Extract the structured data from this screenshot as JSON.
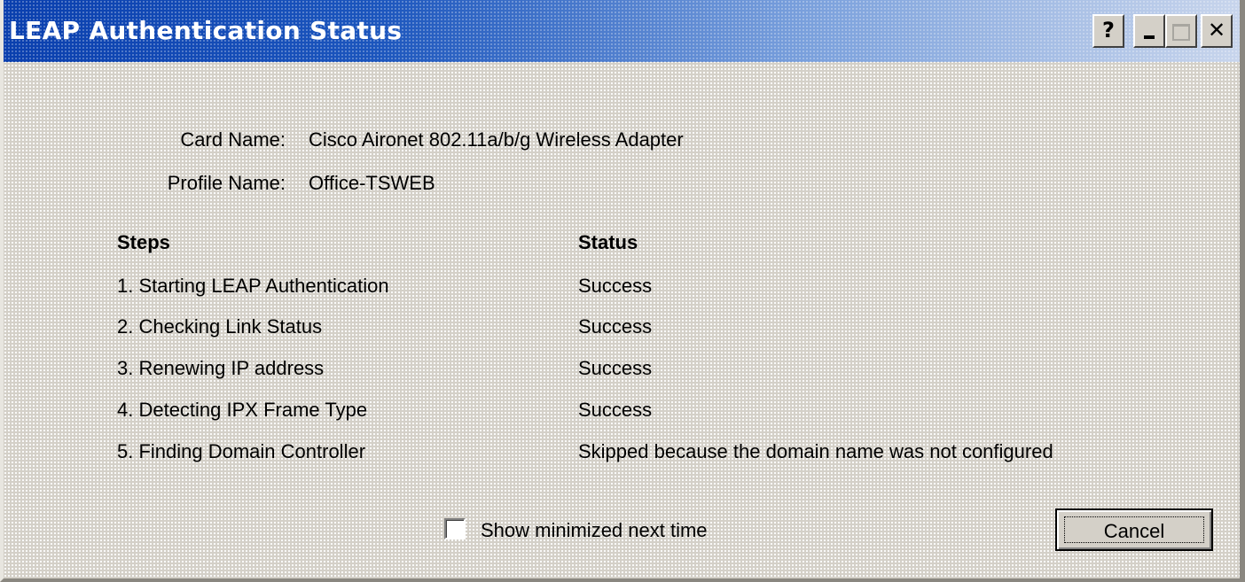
{
  "window": {
    "title": "LEAP Authentication Status",
    "help_label": "?"
  },
  "info": {
    "card_name_label": "Card Name:",
    "card_name_value": "Cisco Aironet 802.11a/b/g Wireless Adapter",
    "profile_name_label": "Profile Name:",
    "profile_name_value": "Office-TSWEB"
  },
  "table": {
    "headers": [
      "Steps",
      "Status"
    ],
    "rows": [
      {
        "step": "1. Starting LEAP Authentication",
        "status": "Success"
      },
      {
        "step": "2. Checking Link Status",
        "status": "Success"
      },
      {
        "step": "3. Renewing IP address",
        "status": "Success"
      },
      {
        "step": "4. Detecting IPX Frame Type",
        "status": "Success"
      },
      {
        "step": "5. Finding Domain Controller",
        "status": "Skipped because the domain name was not configured"
      }
    ]
  },
  "footer": {
    "checkbox_label": "Show minimized next time",
    "checkbox_checked": false,
    "cancel_label": "Cancel"
  },
  "colors": {
    "title_bar_start": "#0a3fae",
    "title_bar_end": "#c8d5ec",
    "dialog_background": "#d4d0c8"
  }
}
